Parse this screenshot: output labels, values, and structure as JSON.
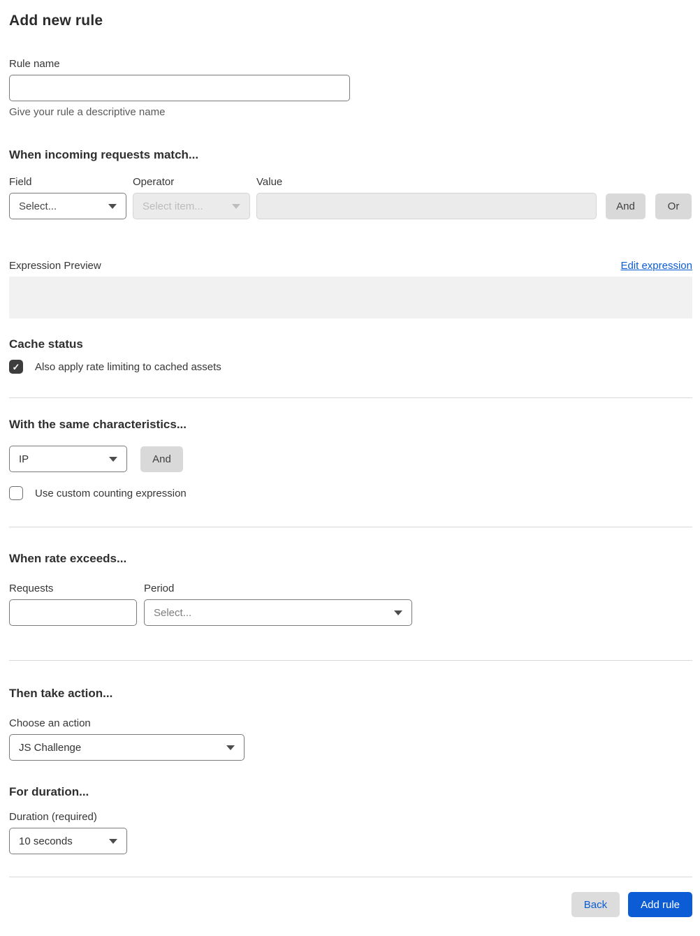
{
  "page": {
    "title": "Add new rule"
  },
  "colors": {
    "accent_blue": "#0b5cd5",
    "button_gray": "#d9d9d9",
    "disabled_field_bg": "#ebebeb",
    "checkbox_checked": "#3d3d3d",
    "preview_box_bg": "#f1f1f1"
  },
  "rule_name": {
    "label": "Rule name",
    "value": "",
    "helper": "Give your rule a descriptive name"
  },
  "match_section": {
    "heading": "When incoming requests match...",
    "field": {
      "label": "Field",
      "selected": "Select..."
    },
    "operator": {
      "label": "Operator",
      "selected": "Select item...",
      "disabled": true
    },
    "value": {
      "label": "Value",
      "value": "",
      "disabled": true
    },
    "and_button": "And",
    "or_button": "Or",
    "expression_preview_label": "Expression Preview",
    "edit_expression_link": "Edit expression",
    "expression_value": ""
  },
  "cache_status": {
    "heading": "Cache status",
    "checkbox_label": "Also apply rate limiting to cached assets",
    "checked": true
  },
  "characteristics": {
    "heading": "With the same characteristics...",
    "selected": "IP",
    "and_button": "And",
    "checkbox_label": "Use custom counting expression",
    "checked": false
  },
  "rate": {
    "heading": "When rate exceeds...",
    "requests": {
      "label": "Requests",
      "value": ""
    },
    "period": {
      "label": "Period",
      "selected": "Select..."
    }
  },
  "action": {
    "heading": "Then take action...",
    "label": "Choose an action",
    "selected": "JS Challenge"
  },
  "duration": {
    "heading": "For duration...",
    "label": "Duration (required)",
    "selected": "10 seconds"
  },
  "footer": {
    "back_button": "Back",
    "submit_button": "Add rule"
  }
}
